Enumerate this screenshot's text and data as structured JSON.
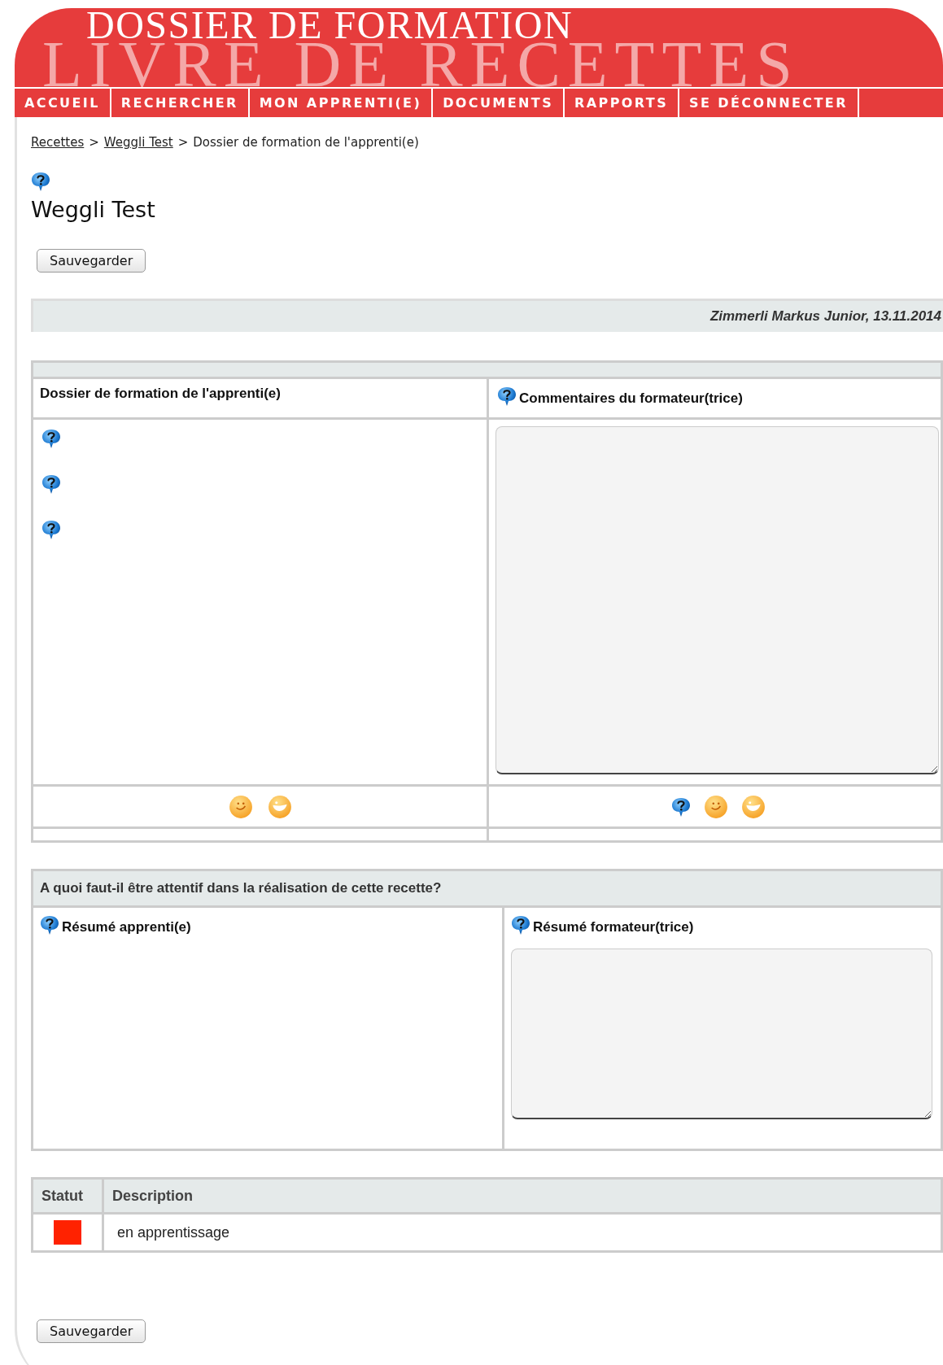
{
  "header": {
    "title": "DOSSIER DE FORMATION",
    "subtitle": "LIVRE DE RECETTES"
  },
  "nav": [
    {
      "label": "ACCUEIL"
    },
    {
      "label": "RECHERCHER"
    },
    {
      "label": "MON APPRENTI(E)"
    },
    {
      "label": "DOCUMENTS"
    },
    {
      "label": "RAPPORTS"
    },
    {
      "label": "SE DÉCONNECTER"
    }
  ],
  "breadcrumb": {
    "links": [
      "Recettes",
      "Weggli Test"
    ],
    "separators": [
      ">",
      ">"
    ],
    "current": "Dossier de formation de l'apprenti(e)"
  },
  "page_title": "Weggli Test",
  "save_button_top": "Sauvegarder",
  "author_bar": "Zimmerli Markus Junior, 13.11.2014",
  "dossier_table": {
    "left_heading": "Dossier de formation de l'apprenti(e)",
    "right_heading": "Commentaires du formateur(trice)"
  },
  "summary_table": {
    "question": "A quoi faut-il être attentif dans la réalisation de cette recette?",
    "left_heading": "Résumé apprenti(e)",
    "right_heading": "Résumé formateur(trice)"
  },
  "status_table": {
    "columns": [
      "Statut",
      "Description"
    ],
    "rows": [
      {
        "color": "#ff2200",
        "description": "en apprentissage"
      }
    ]
  },
  "save_button_bottom": "Sauvegarder"
}
